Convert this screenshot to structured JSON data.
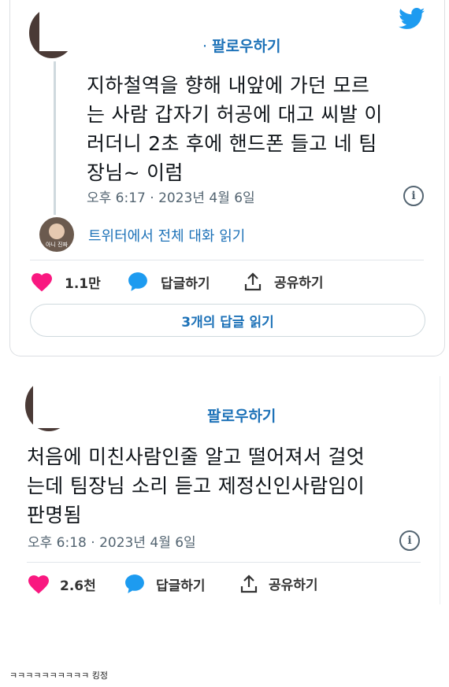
{
  "tweet1": {
    "follow_dot": "·",
    "follow_label": "팔로우하기",
    "text_lines": [
      "지하철역을 향해 내앞에 가던 모르",
      "는 사람 갑자기 허공에 대고 씨발 이",
      "러더니 2초 후에 핸드폰 들고 네 팀",
      "장님~ 이럼"
    ],
    "timestamp": "오후 6:17 · 2023년 4월 6일",
    "conversation_link": "트위터에서 전체 대화 읽기",
    "avatar_caption": "아니 진짜",
    "likes": "1.1만",
    "reply_label": "답글하기",
    "share_label": "공유하기",
    "read_replies": "3개의 답글 읽기"
  },
  "tweet2": {
    "follow_label": "팔로우하기",
    "text_lines": [
      "처음에 미친사람인줄 알고 떨어져서 걸엇",
      "는데 팀장님 소리 듣고 제정신인사람임이",
      "판명됨"
    ],
    "timestamp": "오후 6:18 · 2023년 4월 6일",
    "likes": "2.6천",
    "reply_label": "답글하기",
    "share_label": "공유하기"
  },
  "caption": "ㅋㅋㅋㅋㅋㅋㅋㅋㅋㅋ 킹정",
  "colors": {
    "link": "#1d72b8",
    "heart": "#f91880",
    "twitter": "#1d9bf0",
    "muted": "#536471"
  },
  "icons": [
    "twitter-bird-icon",
    "info-icon",
    "heart-icon",
    "reply-bubble-icon",
    "share-icon"
  ]
}
